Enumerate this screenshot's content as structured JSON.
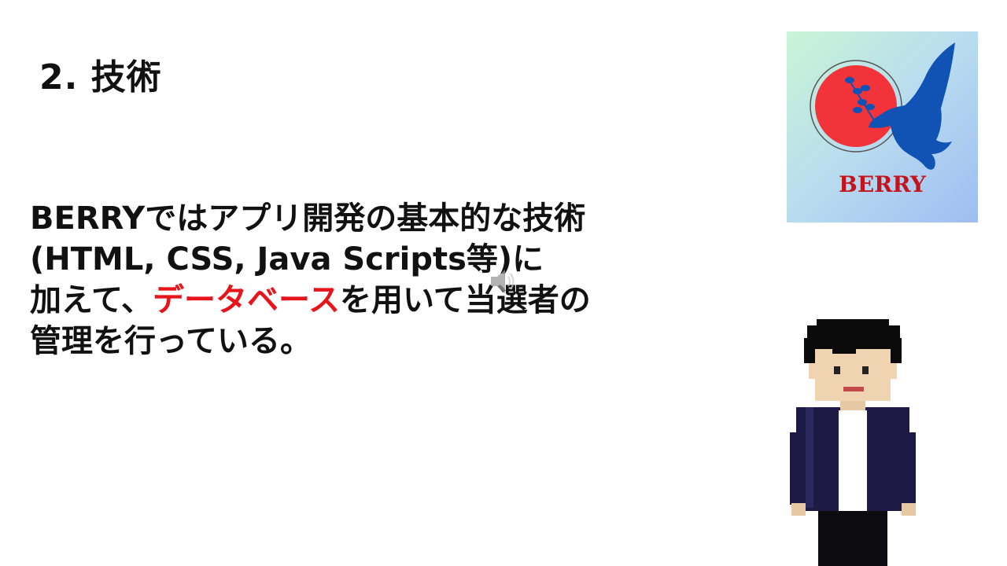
{
  "slide": {
    "title": "2. 技術",
    "body": {
      "line1": "BERRYではアプリ開発の基本的な技術",
      "line2": "(HTML, CSS, Java Scripts等)に",
      "line3_before": "加えて、",
      "line3_accent": "データベース",
      "line3_after": "を用いて当選者の",
      "line4": "管理を行っている。"
    },
    "accent_color": "#e8141c",
    "logo": {
      "text": "BERRY"
    },
    "icons": {
      "audio": "speaker-icon"
    }
  }
}
